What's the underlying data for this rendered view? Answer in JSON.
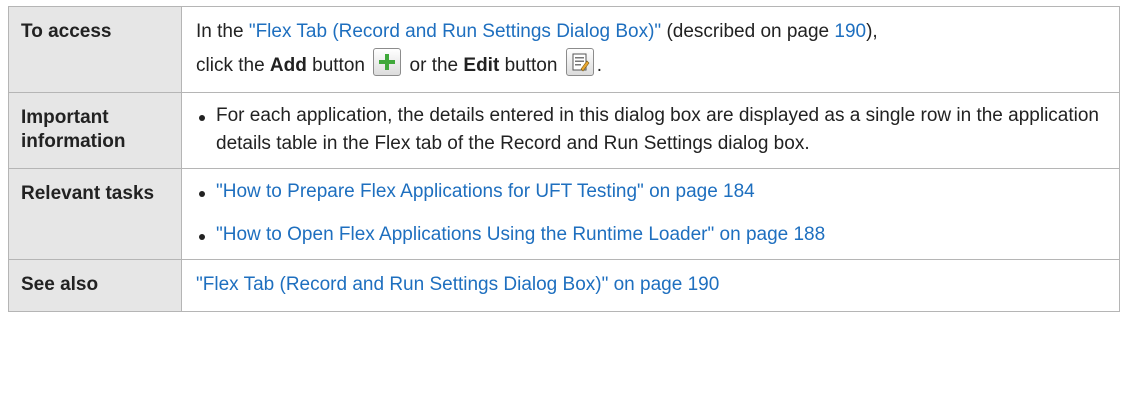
{
  "rows": {
    "access": {
      "label": "To access",
      "text_in_the": "In the ",
      "flex_tab_link": "\"Flex Tab (Record and Run Settings Dialog Box)\"",
      "text_described": " (described on page ",
      "page_link": "190",
      "text_close": "),",
      "text_click_the": "click the ",
      "add_label": "Add",
      "text_button_or": " button ",
      "text_or_the": " or the ",
      "edit_label": "Edit",
      "text_button": " button ",
      "text_period": "."
    },
    "important": {
      "label": "Important information",
      "bullet": "For each application, the details entered in this dialog box are displayed as a single row in the application details table in the Flex tab of the Record and Run Settings dialog box."
    },
    "tasks": {
      "label": "Relevant tasks",
      "links": [
        "\"How to Prepare Flex Applications for UFT Testing\" on page 184",
        "\"How to Open Flex Applications Using the Runtime Loader\" on page 188"
      ]
    },
    "see_also": {
      "label": "See also",
      "link": "\"Flex Tab (Record and Run Settings Dialog Box)\" on page 190"
    }
  },
  "colors": {
    "link": "#1e6fbf",
    "label_bg": "#e6e6e6",
    "border": "#b5b5b5",
    "add_icon": "#3fa83a"
  },
  "icons": {
    "add": "green-plus-icon",
    "edit": "edit-document-icon"
  }
}
